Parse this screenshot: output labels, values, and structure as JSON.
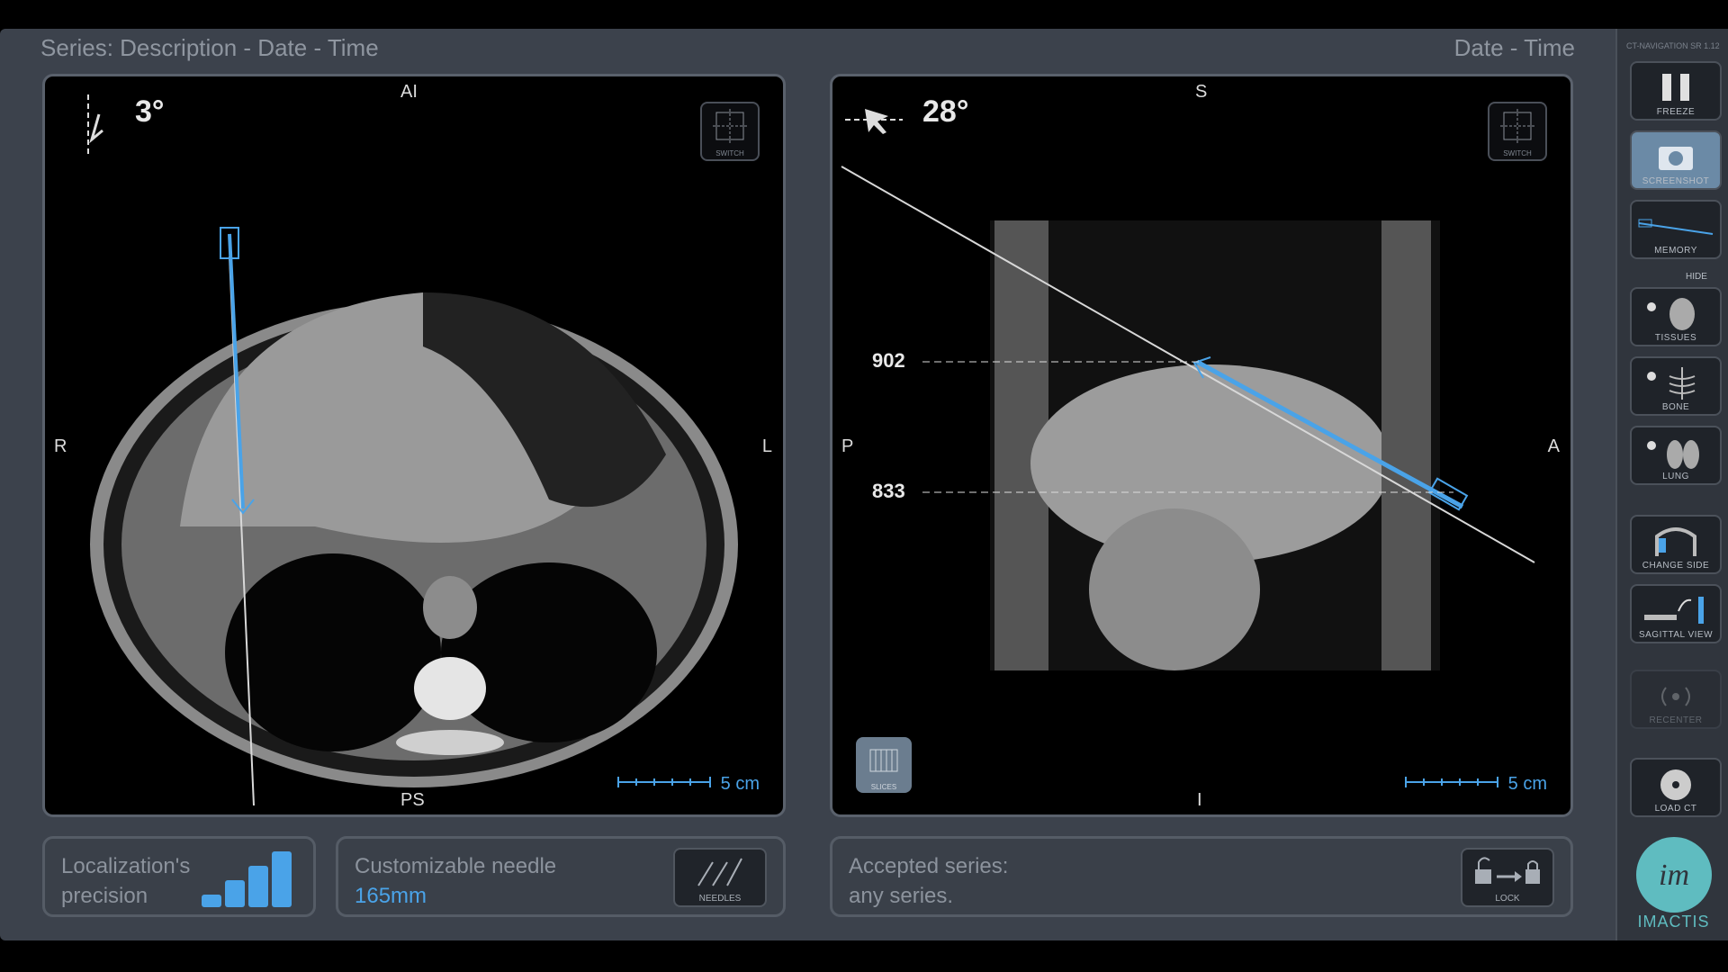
{
  "header": {
    "left": "Series: Description - Date - Time",
    "right": "Date - Time"
  },
  "axial": {
    "angle": "3°",
    "orient": {
      "top": "AI",
      "bottom": "PS",
      "left": "R",
      "right": "L"
    },
    "switch_label": "SWITCH",
    "scale": "5 cm"
  },
  "sagittal": {
    "angle": "28°",
    "orient": {
      "top": "S",
      "bottom": "I",
      "left": "P",
      "right": "A"
    },
    "switch_label": "SWITCH",
    "scale": "5 cm",
    "markers": [
      "902",
      "833"
    ],
    "slices_label": "SLICES"
  },
  "panels": {
    "precision": {
      "line1": "Localization's",
      "line2": "precision",
      "level": 3,
      "levels": 4
    },
    "needle": {
      "title": "Customizable needle",
      "value": "165mm",
      "button": "NEEDLES"
    },
    "series": {
      "line1": "Accepted series:",
      "line2": "any series.",
      "button": "LOCK"
    }
  },
  "sidebar": {
    "version": "CT-NAVIGATION SR 1.12",
    "buttons": [
      {
        "label": "FREEZE",
        "icon": "pause-icon"
      },
      {
        "label": "SCREENSHOT",
        "icon": "camera-icon"
      },
      {
        "label": "MEMORY",
        "icon": "needle-memory-icon"
      },
      {
        "label": "TISSUES",
        "icon": "tissues-icon"
      },
      {
        "label": "BONE",
        "icon": "bone-icon"
      },
      {
        "label": "LUNG",
        "icon": "lung-icon"
      },
      {
        "label": "CHANGE SIDE",
        "icon": "change-side-icon"
      },
      {
        "label": "SAGITTAL VIEW",
        "icon": "sagittal-view-icon"
      },
      {
        "label": "RECENTER",
        "icon": "recenter-icon"
      },
      {
        "label": "LOAD CT",
        "icon": "disc-icon"
      }
    ],
    "hide_label": "HIDE",
    "logo_text": "IMACTIS",
    "logo_mark": "im"
  },
  "colors": {
    "accent": "#4aa3e8",
    "background": "#3c424c",
    "logo": "#5fbcc0"
  }
}
